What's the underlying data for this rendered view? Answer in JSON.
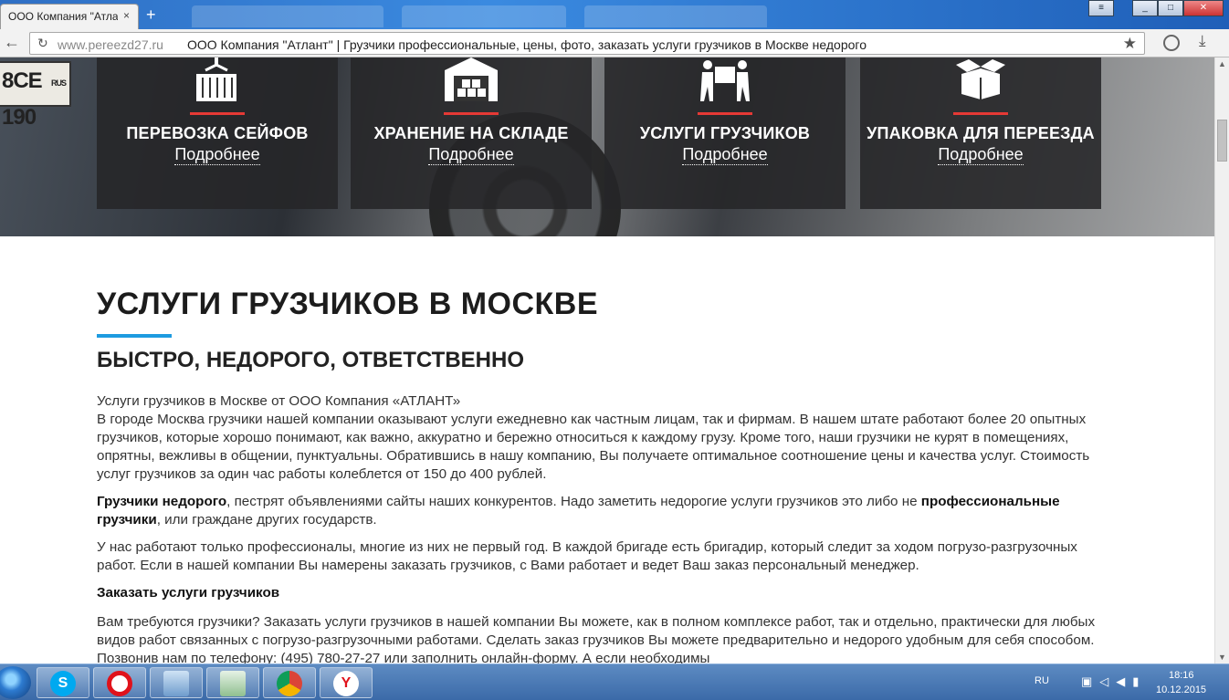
{
  "browser": {
    "tab_title": "ООО Компания \"Атла",
    "tab_close": "×",
    "new_tab": "+",
    "url_host": "www.pereezd27.ru",
    "url_title": "ООО Компания \"Атлант\" | Грузчики профессиональные, цены, фото, заказать услуги грузчиков в Москве недорого",
    "icons": [
      "back-icon",
      "reload-icon",
      "star-icon",
      "globe-icon",
      "download-icon"
    ]
  },
  "hero": {
    "plate": "8CE 190",
    "plate_region": "RUS",
    "cards": [
      {
        "title": "ПЕРЕВОЗКА СЕЙФОВ",
        "link": "Подробнее",
        "icon": "safe-crane-icon"
      },
      {
        "title": "ХРАНЕНИЕ НА СКЛАДЕ",
        "link": "Подробнее",
        "icon": "warehouse-icon"
      },
      {
        "title": "УСЛУГИ ГРУЗЧИКОВ",
        "link": "Подробнее",
        "icon": "movers-icon"
      },
      {
        "title": "УПАКОВКА ДЛЯ ПЕРЕЕЗДА",
        "link": "Подробнее",
        "icon": "box-icon"
      }
    ],
    "accent_color": "#e53935"
  },
  "main": {
    "title": "УСЛУГИ ГРУЗЧИКОВ В МОСКВЕ",
    "title_bar_color": "#1e9be0",
    "subtitle": "БЫСТРО, НЕДОРОГО, ОТВЕТСТВЕННО",
    "intro": "Услуги грузчиков в Москве от ООО Компания «АТЛАНТ»",
    "p1": "В городе Москва грузчики нашей компании оказывают услуги ежедневно как частным лицам, так и фирмам. В нашем штате работают более 20 опытных грузчиков, которые хорошо понимают, как важно, аккуратно и бережно относиться к каждому грузу. Кроме того, наши грузчики не курят в помещениях, опрятны, вежливы в общении, пунктуальны. Обратившись в нашу компанию, Вы получаете оптимальное соотношение цены и качества услуг. Стоимость услуг грузчиков за один час работы колеблется от 150 до 400 рублей.",
    "p2_bold1": "Грузчики недорого",
    "p2_text1": ", пестрят объявлениями сайты наших конкурентов. Надо заметить недорогие услуги грузчиков это либо не ",
    "p2_bold2": "профессиональные грузчики",
    "p2_text2": ", или граждане других государств.",
    "p3": "У нас работают только профессионалы, многие из них не первый год. В каждой бригаде есть бригадир, который следит за ходом погрузо-разгрузочных работ. Если в нашей компании Вы намерены заказать грузчиков, с Вами работает и ведет Ваш заказ персональный менеджер.",
    "order_heading": "Заказать услуги грузчиков",
    "p4": "Вам требуются грузчики? Заказать услуги грузчиков в нашей компании Вы можете, как в полном комплексе работ, так и отдельно, практически для любых видов работ связанных с погрузо-разгрузочными работами. Сделать заказ грузчиков Вы можете предварительно и недорого удобным для себя способом. Позвонив нам по телефону: (495) 780-27-27 или заполнить онлайн-форму. А если необходимы"
  },
  "taskbar": {
    "apps": [
      "skype-icon",
      "opera-icon",
      "computer-icon",
      "notepad-icon",
      "chrome-icon",
      "yandex-icon"
    ],
    "skype_letter": "S",
    "yandex_letter": "Y",
    "lang": "RU",
    "time": "18:16",
    "date": "10.12.2015"
  }
}
